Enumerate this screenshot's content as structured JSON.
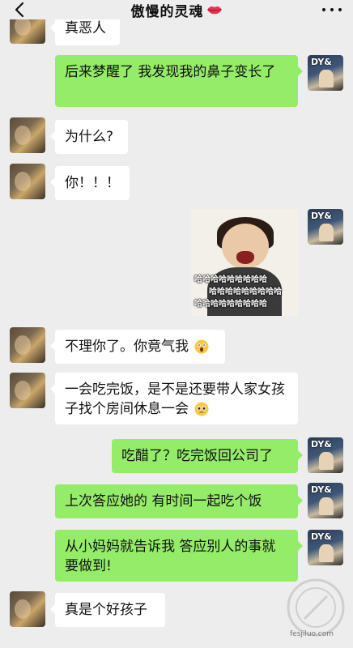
{
  "header": {
    "title": "傲慢的灵魂",
    "back_icon": "chevron-left-icon",
    "more_icon": "more-dots-icon",
    "title_emoji": "lips-icon"
  },
  "colors": {
    "background": "#ededed",
    "my_bubble": "#95ec69",
    "their_bubble": "#ffffff"
  },
  "avatars": {
    "mine_text": "DY&",
    "theirs_icon": "photo-avatar"
  },
  "messages": [
    {
      "from": "them",
      "text": "真恶人"
    },
    {
      "from": "me",
      "text": "后来梦醒了 我发现我的鼻子变长了"
    },
    {
      "from": "them",
      "text": "为什么?"
    },
    {
      "from": "them",
      "text": "你！！！"
    },
    {
      "from": "me",
      "type": "sticker",
      "lines": [
        "哈哈哈哈哈哈哈哈哈",
        "哈哈哈哈哈哈哈哈哈",
        "哈哈哈哈哈哈哈哈哈"
      ]
    },
    {
      "from": "them",
      "text": "不理你了。你竟气我",
      "emoji": "scream-face-icon"
    },
    {
      "from": "them",
      "text": "一会吃完饭，是不是还要带人家女孩子找个房间休息一会",
      "emoji": "pleading-face-icon"
    },
    {
      "from": "me",
      "text": "吃醋了？吃完饭回公司了"
    },
    {
      "from": "me",
      "text": "上次答应她的 有时间一起吃个饭"
    },
    {
      "from": "me",
      "text": "从小妈妈就告诉我 答应别人的事就要做到!"
    },
    {
      "from": "them",
      "text": "真是个好孩子"
    }
  ],
  "watermark": {
    "text": "fesjiluo.com"
  }
}
